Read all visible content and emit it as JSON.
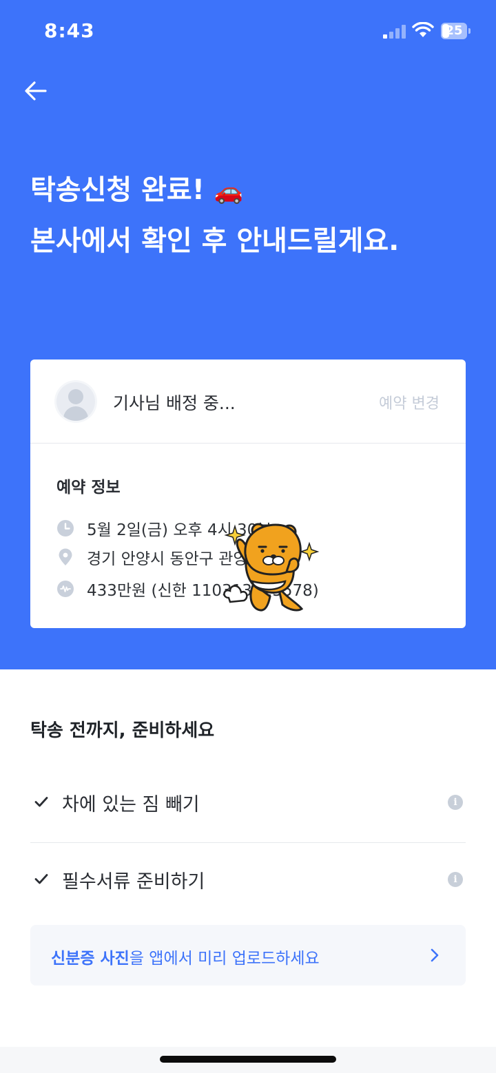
{
  "status_bar": {
    "time": "8:43",
    "battery": "25"
  },
  "hero": {
    "title_line1": "탁송신청 완료!",
    "title_emoji": "🚗",
    "title_line2": "본사에서 확인 후 안내드릴게요."
  },
  "card": {
    "driver_status": "기사님 배정 중...",
    "change_label": "예약 변경",
    "info_title": "예약 정보",
    "rows": [
      {
        "icon": "clock-icon",
        "text": "5월 2일(금) 오후 4시 30분"
      },
      {
        "icon": "location-pin-icon",
        "text": "경기 안양시 동안구 관양동 10"
      },
      {
        "icon": "payment-icon",
        "text": "433만원 (신한 110313825578)"
      }
    ]
  },
  "prepare": {
    "title": "탁송 전까지, 준비하세요",
    "items": [
      {
        "label": "차에 있는 짐 빼기"
      },
      {
        "label": "필수서류 준비하기"
      }
    ]
  },
  "banner": {
    "strong": "신분증 사진",
    "rest": "을 앱에서 미리 업로드하세요"
  },
  "colors": {
    "brand_blue": "#3d73fa",
    "muted": "#c5ccd8"
  }
}
